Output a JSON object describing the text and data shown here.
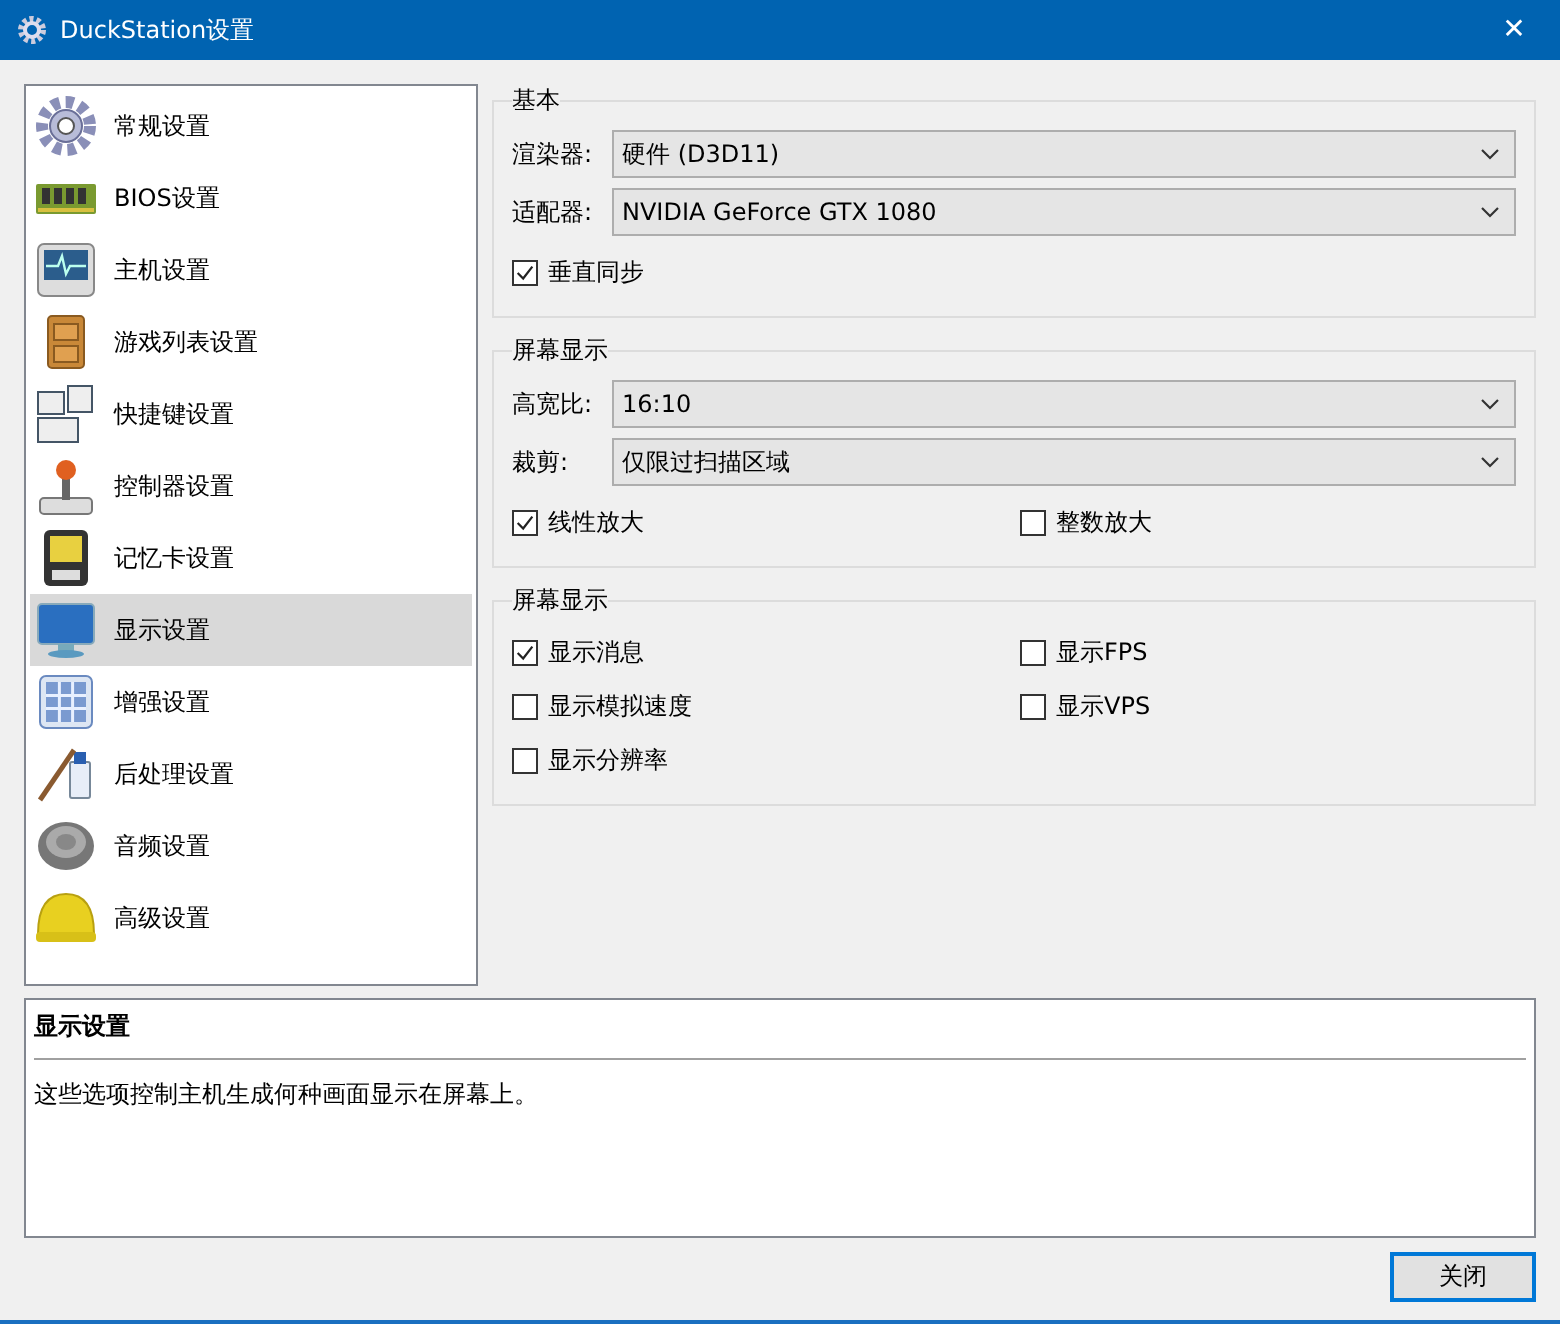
{
  "window": {
    "title": "DuckStation设置",
    "close": "✕"
  },
  "sidebar": {
    "items": [
      {
        "label": "常规设置",
        "selected": false
      },
      {
        "label": "BIOS设置",
        "selected": false
      },
      {
        "label": "主机设置",
        "selected": false
      },
      {
        "label": "游戏列表设置",
        "selected": false
      },
      {
        "label": "快捷键设置",
        "selected": false
      },
      {
        "label": "控制器设置",
        "selected": false
      },
      {
        "label": "记忆卡设置",
        "selected": false
      },
      {
        "label": "显示设置",
        "selected": true
      },
      {
        "label": "增强设置",
        "selected": false
      },
      {
        "label": "后处理设置",
        "selected": false
      },
      {
        "label": "音频设置",
        "selected": false
      },
      {
        "label": "高级设置",
        "selected": false
      }
    ]
  },
  "groups": [
    {
      "title": "基本",
      "rows": [
        {
          "kind": "select",
          "label": "渲染器:",
          "value": "硬件 (D3D11)"
        },
        {
          "kind": "select",
          "label": "适配器:",
          "value": "NVIDIA GeForce GTX 1080"
        },
        {
          "kind": "checks",
          "items": [
            {
              "label": "垂直同步",
              "checked": true
            }
          ]
        }
      ]
    },
    {
      "title": "屏幕显示",
      "rows": [
        {
          "kind": "select",
          "label": "高宽比:",
          "value": "16:10"
        },
        {
          "kind": "select",
          "label": "裁剪:",
          "value": "仅限过扫描区域"
        },
        {
          "kind": "checks",
          "items": [
            {
              "label": "线性放大",
              "checked": true
            },
            {
              "label": "整数放大",
              "checked": false
            }
          ]
        }
      ]
    },
    {
      "title": "屏幕显示",
      "rows": [
        {
          "kind": "checks",
          "items": [
            {
              "label": "显示消息",
              "checked": true
            },
            {
              "label": "显示FPS",
              "checked": false
            }
          ]
        },
        {
          "kind": "checks",
          "items": [
            {
              "label": "显示模拟速度",
              "checked": false
            },
            {
              "label": "显示VPS",
              "checked": false
            }
          ]
        },
        {
          "kind": "checks",
          "items": [
            {
              "label": "显示分辨率",
              "checked": false
            }
          ]
        }
      ]
    }
  ],
  "description": {
    "title": "显示设置",
    "text": "这些选项控制主机生成何种画面显示在屏幕上。"
  },
  "buttons": [
    {
      "label": "关闭"
    }
  ]
}
